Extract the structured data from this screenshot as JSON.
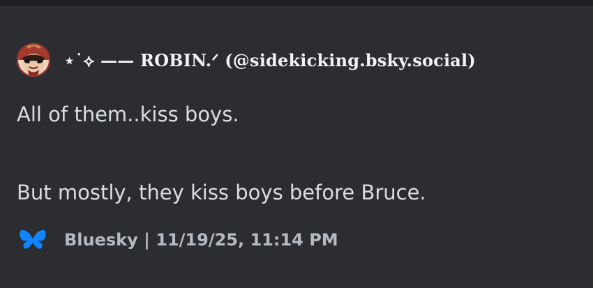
{
  "embed": {
    "author": {
      "name": "⋆˙⟡ —— ROBIN.ᐟ (@sidekicking.bsky.social)",
      "avatar_icon": "robin-avatar"
    },
    "description_lines": [
      "All of them..kiss boys.",
      "",
      "But mostly, they kiss boys before Bruce."
    ],
    "footer": {
      "icon": "bluesky-butterfly-icon",
      "text": "Bluesky | 11/19/25, 11:14 PM",
      "icon_color": "#1185fe"
    }
  },
  "colors": {
    "background": "#2b2d31",
    "top_strip": "#1e1f22",
    "author_text": "#f2f3f5",
    "description_text": "#dbdee1",
    "footer_text": "#b5bac1"
  }
}
